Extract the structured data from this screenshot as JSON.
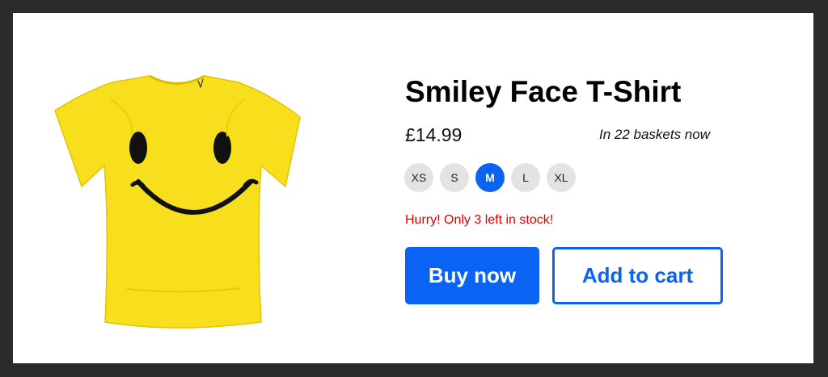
{
  "product": {
    "title": "Smiley Face T-Shirt",
    "price": "£14.99",
    "baskets_text": "In 22 baskets now",
    "sizes": [
      {
        "label": "XS",
        "selected": false
      },
      {
        "label": "S",
        "selected": false
      },
      {
        "label": "M",
        "selected": true
      },
      {
        "label": "L",
        "selected": false
      },
      {
        "label": "XL",
        "selected": false
      }
    ],
    "stock_message": "Hurry! Only 3 left in stock!",
    "image_icon": "smiley-tshirt-image"
  },
  "actions": {
    "buy_label": "Buy now",
    "cart_label": "Add to cart"
  },
  "colors": {
    "accent": "#0a63f2",
    "alert": "#e00000",
    "shirt": "#f7df1e",
    "size_chip": "#e3e3e3",
    "frame_background": "#2b2b2b"
  }
}
